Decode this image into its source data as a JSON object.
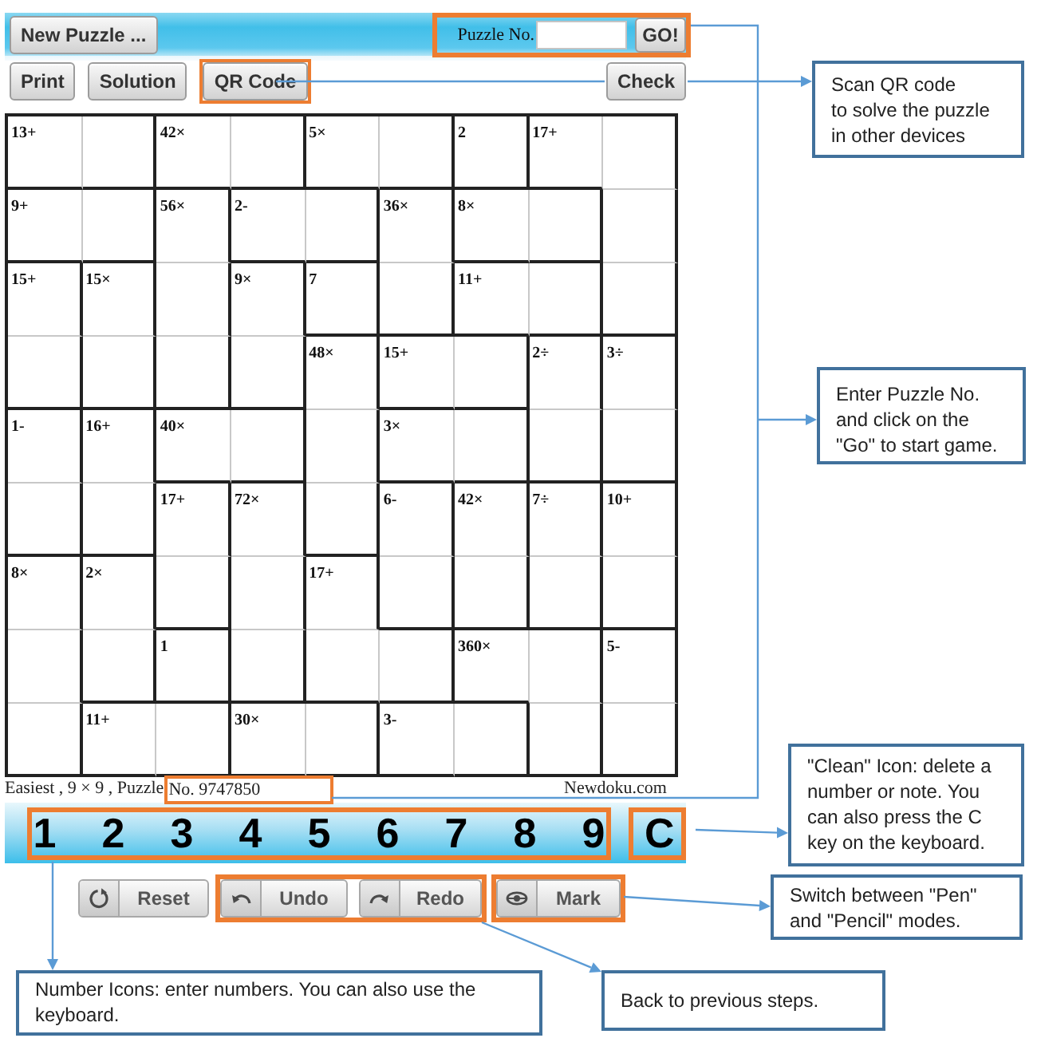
{
  "toolbar": {
    "new_puzzle": "New Puzzle ...",
    "lookup": {
      "label": "Puzzle No.",
      "button": "GO!",
      "highlighted": true
    }
  },
  "actions": [
    {
      "label": "Print",
      "highlighted": false
    },
    {
      "label": "Solution",
      "highlighted": false
    },
    {
      "label": "QR Code",
      "highlighted": true
    },
    {
      "label": "Check",
      "highlighted": false
    }
  ],
  "grid": [
    [
      {
        "clue": "13+",
        "wall_right": false,
        "wall_below": true
      },
      {
        "wall_right": true,
        "wall_below": true
      },
      {
        "clue": "42×",
        "wall_right": false,
        "wall_below": true
      },
      {
        "wall_right": true,
        "wall_below": true
      },
      {
        "clue": "5×",
        "wall_right": false,
        "wall_below": true
      },
      {
        "wall_right": true,
        "wall_below": true
      },
      {
        "clue": "2",
        "wall_right": true,
        "wall_below": true
      },
      {
        "clue": "17+",
        "wall_right": false,
        "wall_below": true
      },
      {
        "wall_right": true,
        "wall_below": false
      }
    ],
    [
      {
        "clue": "9+",
        "wall_right": false,
        "wall_below": true
      },
      {
        "wall_right": true,
        "wall_below": true
      },
      {
        "clue": "56×",
        "wall_right": true,
        "wall_below": false
      },
      {
        "clue": "2-",
        "wall_right": false,
        "wall_below": true
      },
      {
        "wall_right": true,
        "wall_below": true
      },
      {
        "clue": "36×",
        "wall_right": true,
        "wall_below": false
      },
      {
        "clue": "8×",
        "wall_right": false,
        "wall_below": true
      },
      {
        "wall_right": true,
        "wall_below": true
      },
      {
        "wall_right": true,
        "wall_below": false
      }
    ],
    [
      {
        "clue": "15+",
        "wall_right": true,
        "wall_below": false
      },
      {
        "clue": "15×",
        "wall_right": true,
        "wall_below": false
      },
      {
        "wall_right": true,
        "wall_below": false
      },
      {
        "clue": "9×",
        "wall_right": true,
        "wall_below": false
      },
      {
        "clue": "7",
        "wall_right": true,
        "wall_below": true
      },
      {
        "wall_right": true,
        "wall_below": true
      },
      {
        "clue": "11+",
        "wall_right": false,
        "wall_below": true
      },
      {
        "wall_right": true,
        "wall_below": true
      },
      {
        "wall_right": true,
        "wall_below": true
      }
    ],
    [
      {
        "wall_right": true,
        "wall_below": true
      },
      {
        "wall_right": true,
        "wall_below": true
      },
      {
        "wall_right": true,
        "wall_below": true
      },
      {
        "wall_right": true,
        "wall_below": true
      },
      {
        "clue": "48×",
        "wall_right": true,
        "wall_below": false
      },
      {
        "clue": "15+",
        "wall_right": false,
        "wall_below": true
      },
      {
        "wall_right": true,
        "wall_below": true
      },
      {
        "clue": "2÷",
        "wall_right": true,
        "wall_below": false
      },
      {
        "clue": "3÷",
        "wall_right": true,
        "wall_below": false
      }
    ],
    [
      {
        "clue": "1-",
        "wall_right": true,
        "wall_below": false
      },
      {
        "clue": "16+",
        "wall_right": true,
        "wall_below": false
      },
      {
        "clue": "40×",
        "wall_right": false,
        "wall_below": true
      },
      {
        "wall_right": true,
        "wall_below": true
      },
      {
        "wall_right": true,
        "wall_below": false
      },
      {
        "clue": "3×",
        "wall_right": false,
        "wall_below": true
      },
      {
        "wall_right": true,
        "wall_below": true
      },
      {
        "wall_right": true,
        "wall_below": true
      },
      {
        "wall_right": true,
        "wall_below": true
      }
    ],
    [
      {
        "wall_right": true,
        "wall_below": true
      },
      {
        "wall_right": true,
        "wall_below": true
      },
      {
        "clue": "17+",
        "wall_right": true,
        "wall_below": false
      },
      {
        "clue": "72×",
        "wall_right": true,
        "wall_below": false
      },
      {
        "wall_right": true,
        "wall_below": true
      },
      {
        "clue": "6-",
        "wall_right": true,
        "wall_below": false
      },
      {
        "clue": "42×",
        "wall_right": true,
        "wall_below": false
      },
      {
        "clue": "7÷",
        "wall_right": true,
        "wall_below": false
      },
      {
        "clue": "10+",
        "wall_right": true,
        "wall_below": false
      }
    ],
    [
      {
        "clue": "8×",
        "wall_right": true,
        "wall_below": false
      },
      {
        "clue": "2×",
        "wall_right": true,
        "wall_below": false
      },
      {
        "wall_right": true,
        "wall_below": true
      },
      {
        "wall_right": true,
        "wall_below": false
      },
      {
        "clue": "17+",
        "wall_right": true,
        "wall_below": false
      },
      {
        "wall_right": true,
        "wall_below": true
      },
      {
        "wall_right": true,
        "wall_below": true
      },
      {
        "wall_right": true,
        "wall_below": true
      },
      {
        "wall_right": true,
        "wall_below": true
      }
    ],
    [
      {
        "wall_right": true,
        "wall_below": false
      },
      {
        "wall_right": true,
        "wall_below": true
      },
      {
        "clue": "1",
        "wall_right": true,
        "wall_below": true
      },
      {
        "wall_right": true,
        "wall_below": true
      },
      {
        "wall_right": false,
        "wall_below": true
      },
      {
        "wall_right": true,
        "wall_below": true
      },
      {
        "clue": "360×",
        "wall_right": false,
        "wall_below": true
      },
      {
        "wall_right": true,
        "wall_below": false
      },
      {
        "clue": "5-",
        "wall_right": true,
        "wall_below": false
      }
    ],
    [
      {
        "wall_right": true,
        "wall_below": true
      },
      {
        "clue": "11+",
        "wall_right": false,
        "wall_below": true
      },
      {
        "wall_right": true,
        "wall_below": true
      },
      {
        "clue": "30×",
        "wall_right": false,
        "wall_below": true
      },
      {
        "wall_right": true,
        "wall_below": true
      },
      {
        "clue": "3-",
        "wall_right": false,
        "wall_below": true
      },
      {
        "wall_right": true,
        "wall_below": true
      },
      {
        "wall_right": true,
        "wall_below": true
      },
      {
        "wall_right": true,
        "wall_below": true
      }
    ]
  ],
  "info": {
    "summary": "Easiest , 9 × 9 , Puzzle",
    "puzzle_number": {
      "text": "No. 9747850",
      "highlighted": true
    },
    "site": "Newdoku.com"
  },
  "keypad": {
    "digits": [
      "1",
      "2",
      "3",
      "4",
      "5",
      "6",
      "7",
      "8",
      "9"
    ],
    "digits_highlighted": true,
    "clear": {
      "label": "C",
      "highlighted": true
    }
  },
  "control_groups": [
    {
      "highlighted": false,
      "buttons": [
        {
          "kind": "reset",
          "label": "Reset"
        }
      ]
    },
    {
      "highlighted": true,
      "buttons": [
        {
          "kind": "undo",
          "label": "Undo"
        },
        {
          "kind": "redo",
          "label": "Redo"
        }
      ]
    },
    {
      "highlighted": true,
      "buttons": [
        {
          "kind": "mark",
          "label": "Mark"
        }
      ]
    }
  ],
  "callouts": [
    "Scan QR code\nto solve the puzzle\nin other devices",
    "Enter Puzzle No.\nand click on the\n\"Go\" to start game.",
    "\"Clean\" Icon: delete a\nnumber or note. You\ncan also press the C\nkey on the keyboard.",
    "Switch between \"Pen\"\nand \"Pencil\" modes.",
    "Number Icons: enter numbers. You can also use the\nkeyboard.",
    "Back to previous steps."
  ]
}
